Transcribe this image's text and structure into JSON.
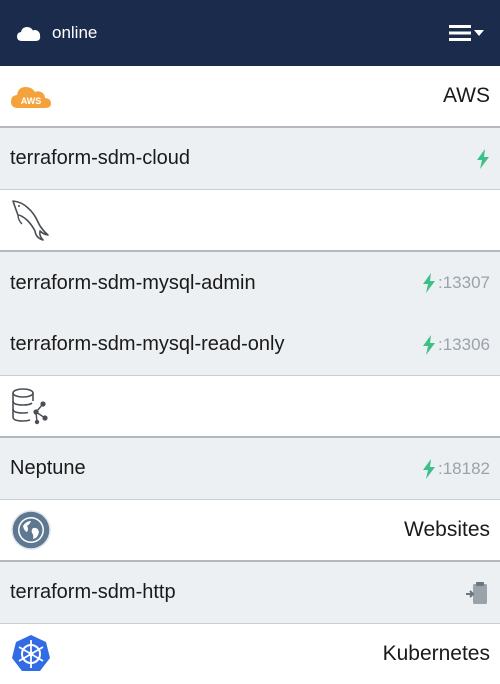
{
  "topbar": {
    "status_icon": "cloud-icon",
    "status_text": "online",
    "menu_icon": "hamburger-menu-icon"
  },
  "colors": {
    "topbar_bg": "#1b2b4b",
    "bolt": "#3dbf8a",
    "aws_orange": "#f4a33c",
    "row_bg": "#edf0f3"
  },
  "groups": {
    "aws": {
      "icon": "aws-cloud-icon",
      "icon_text": "AWS",
      "title": "AWS",
      "items": [
        {
          "label": "terraform-sdm-cloud",
          "icon": "bolt-icon",
          "port": ""
        }
      ]
    },
    "mysql": {
      "icon": "mysql-dolphin-icon",
      "items": [
        {
          "label": "terraform-sdm-mysql-admin",
          "icon": "bolt-icon",
          "port": ":13307"
        },
        {
          "label": "terraform-sdm-mysql-read-only",
          "icon": "bolt-icon",
          "port": ":13306"
        }
      ]
    },
    "neptune": {
      "icon": "graph-database-icon",
      "items": [
        {
          "label": "Neptune",
          "icon": "bolt-icon",
          "port": ":18182"
        }
      ]
    },
    "websites": {
      "icon": "globe-icon",
      "title": "Websites",
      "items": [
        {
          "label": "terraform-sdm-http",
          "icon": "clipboard-copy-icon",
          "port": ""
        }
      ]
    },
    "kubernetes": {
      "icon": "kubernetes-helm-icon",
      "title": "Kubernetes"
    }
  }
}
